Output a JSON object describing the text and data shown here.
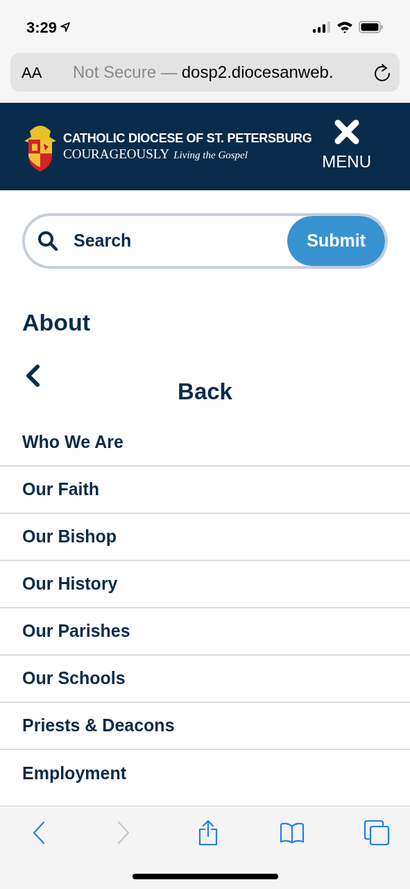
{
  "status_bar": {
    "time": "3:29"
  },
  "address_bar": {
    "text_size_button": "AA",
    "security": "Not Secure —",
    "url": "dosp2.diocesanweb."
  },
  "header": {
    "title": "CATHOLIC DIOCESE OF ST. PETERSBURG",
    "tagline": "COURAGEOUSLY",
    "tagline_script": "Living the Gospel",
    "menu_label": "MENU"
  },
  "search": {
    "placeholder": "Search",
    "submit": "Submit"
  },
  "section_title": "About",
  "back_label": "Back",
  "menu_items": [
    {
      "label": "Who We Are"
    },
    {
      "label": "Our Faith"
    },
    {
      "label": "Our Bishop"
    },
    {
      "label": "Our History"
    },
    {
      "label": "Our Parishes"
    },
    {
      "label": "Our Schools"
    },
    {
      "label": "Priests & Deacons"
    },
    {
      "label": "Employment"
    }
  ],
  "toolbar": [
    {
      "kind": "back",
      "disabled": false
    },
    {
      "kind": "forward",
      "disabled": true
    },
    {
      "kind": "share",
      "disabled": false
    },
    {
      "kind": "bookmarks",
      "disabled": false
    },
    {
      "kind": "tabs",
      "disabled": false
    }
  ]
}
